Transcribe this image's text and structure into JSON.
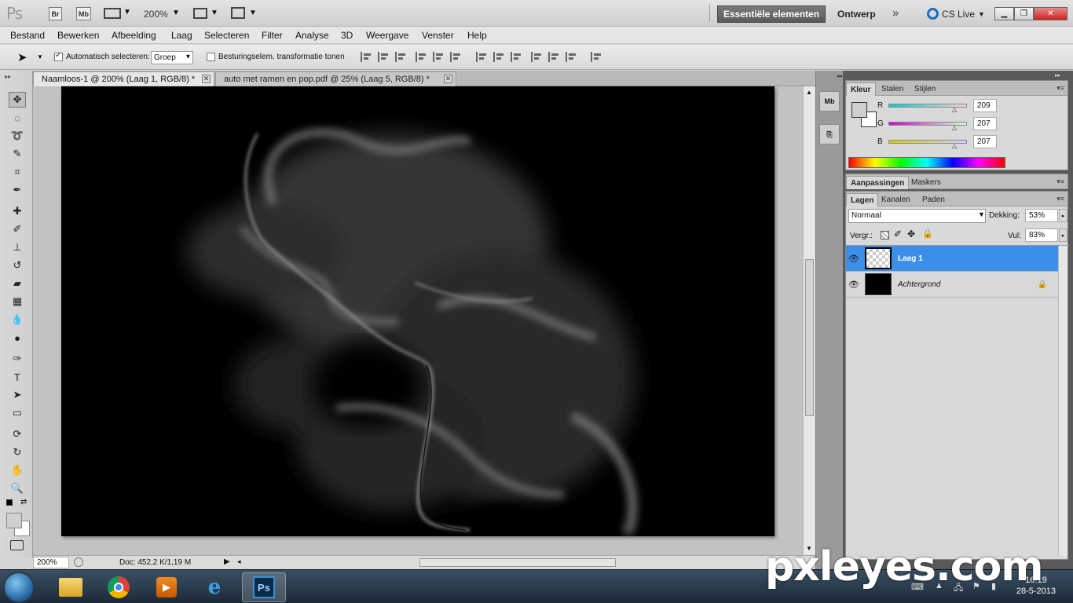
{
  "appbar": {
    "logo": "Ps",
    "bridge_btn": "Br",
    "mini_bridge_btn": "Mb",
    "zoom_level": "200%",
    "workspace_active": "Essentiële elementen",
    "workspace_other": "Ontwerp",
    "cs_live": "CS Live"
  },
  "menu": [
    "Bestand",
    "Bewerken",
    "Afbeelding",
    "Laag",
    "Selecteren",
    "Filter",
    "Analyse",
    "3D",
    "Weergave",
    "Venster",
    "Help"
  ],
  "options": {
    "auto_select_label": "Automatisch selecteren:",
    "auto_select_value": "Groep",
    "transform_label": "Besturingselem. transformatie tonen"
  },
  "doc_tabs": [
    {
      "label": "Naamloos-1 @ 200% (Laag 1, RGB/8) *"
    },
    {
      "label": "auto met ramen en pop.pdf @ 25% (Laag 5, RGB/8) *"
    }
  ],
  "status": {
    "zoom": "200%",
    "doc_info": "Doc: 452,2 K/1,19 M"
  },
  "dock": {
    "mb_label": "Mb"
  },
  "color_panel": {
    "tabs": [
      "Kleur",
      "Stalen",
      "Stijlen"
    ],
    "r_label": "R",
    "r_value": "209",
    "g_label": "G",
    "g_value": "207",
    "b_label": "B",
    "b_value": "207",
    "foreground": "#d1cfcf"
  },
  "adjust_panel": {
    "tabs": [
      "Aanpassingen",
      "Maskers"
    ]
  },
  "layers_panel": {
    "tabs": [
      "Lagen",
      "Kanalen",
      "Paden"
    ],
    "blend_mode": "Normaal",
    "opacity_label": "Dekking:",
    "opacity_value": "53%",
    "lock_label": "Vergr.:",
    "fill_label": "Vul:",
    "fill_value": "83%",
    "layers": [
      {
        "name": "Laag 1",
        "selected": true
      },
      {
        "name": "Achtergrond",
        "selected": false
      }
    ]
  },
  "taskbar": {
    "ps_label": "Ps",
    "time": "16:19",
    "date": "28-5-2013"
  },
  "watermark": "pxleyes.com",
  "colors": {
    "selection": "#3d8ee8",
    "canvas": "#000000"
  }
}
